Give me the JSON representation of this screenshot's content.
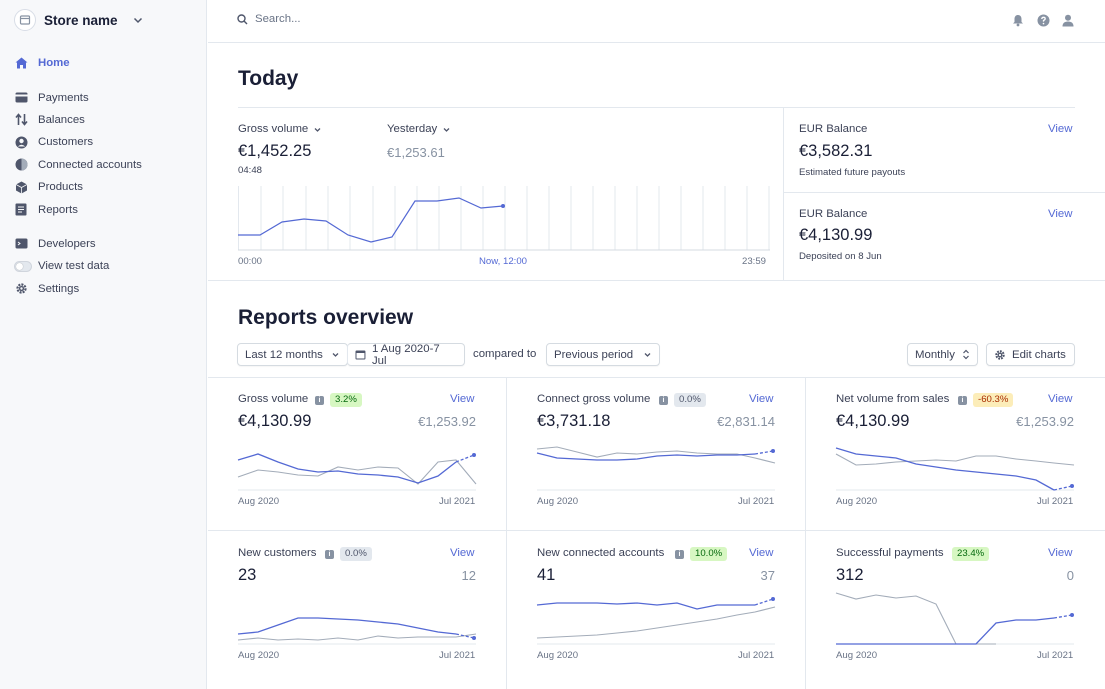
{
  "sidebar": {
    "store_name": "Store name",
    "items": [
      {
        "label": "Home",
        "icon": "home-icon",
        "active": true
      },
      {
        "label": "Payments",
        "icon": "payments-icon"
      },
      {
        "label": "Balances",
        "icon": "balances-icon"
      },
      {
        "label": "Customers",
        "icon": "customers-icon"
      },
      {
        "label": "Connected accounts",
        "icon": "connected-accounts-icon"
      },
      {
        "label": "Products",
        "icon": "products-icon"
      },
      {
        "label": "Reports",
        "icon": "reports-icon"
      },
      {
        "label": "Developers",
        "icon": "developers-icon"
      },
      {
        "label": "View test data",
        "icon": "toggle"
      },
      {
        "label": "Settings",
        "icon": "gear-icon"
      }
    ]
  },
  "topbar": {
    "search_placeholder": "Search..."
  },
  "today": {
    "title": "Today",
    "primary_metric": "Gross volume",
    "primary_value": "€1,452.25",
    "primary_time": "04:48",
    "compare_metric": "Yesterday",
    "compare_value": "€1,253.61",
    "axis_start": "00:00",
    "axis_now": "Now, 12:00",
    "axis_end": "23:59",
    "balances": [
      {
        "title": "EUR Balance",
        "value": "€3,582.31",
        "subtitle": "Estimated future payouts",
        "link": "View"
      },
      {
        "title": "EUR Balance",
        "value": "€4,130.99",
        "subtitle": "Deposited on 8 Jun",
        "link": "View"
      }
    ]
  },
  "reports": {
    "title": "Reports overview",
    "range": "Last 12 months",
    "dates": "1 Aug 2020-7 Jul",
    "compared_to": "compared to",
    "comparison": "Previous period",
    "interval": "Monthly",
    "edit": "Edit charts",
    "cards": [
      {
        "title": "Gross volume",
        "badge": "3.2%",
        "badge_tone": "green",
        "value": "€4,130.99",
        "previous": "€1,253.92",
        "link": "View",
        "x_start": "Aug 2020",
        "x_end": "Jul 2021"
      },
      {
        "title": "Connect gross volume",
        "badge": "0.0%",
        "badge_tone": "gray",
        "value": "€3,731.18",
        "previous": "€2,831.14",
        "link": "View",
        "x_start": "Aug 2020",
        "x_end": "Jul 2021"
      },
      {
        "title": "Net volume from sales",
        "badge": "-60.3%",
        "badge_tone": "orange",
        "value": "€4,130.99",
        "previous": "€1,253.92",
        "link": "View",
        "x_start": "Aug 2020",
        "x_end": "Jul 2021"
      },
      {
        "title": "New customers",
        "badge": "0.0%",
        "badge_tone": "gray",
        "value": "23",
        "previous": "12",
        "link": "View",
        "x_start": "Aug 2020",
        "x_end": "Jul 2021"
      },
      {
        "title": "New connected accounts",
        "badge": "10.0%",
        "badge_tone": "green",
        "value": "41",
        "previous": "37",
        "link": "View",
        "x_start": "Aug 2020",
        "x_end": "Jul 2021"
      },
      {
        "title": "Successful payments",
        "badge": "23.4%",
        "badge_tone": "green",
        "value": "312",
        "previous": "0",
        "link": "View",
        "x_start": "Aug 2020",
        "x_end": "Jul 2021"
      }
    ]
  },
  "colors": {
    "accent": "#5469d4",
    "current_line": "#5469d4",
    "previous_line": "#a3acb9"
  }
}
